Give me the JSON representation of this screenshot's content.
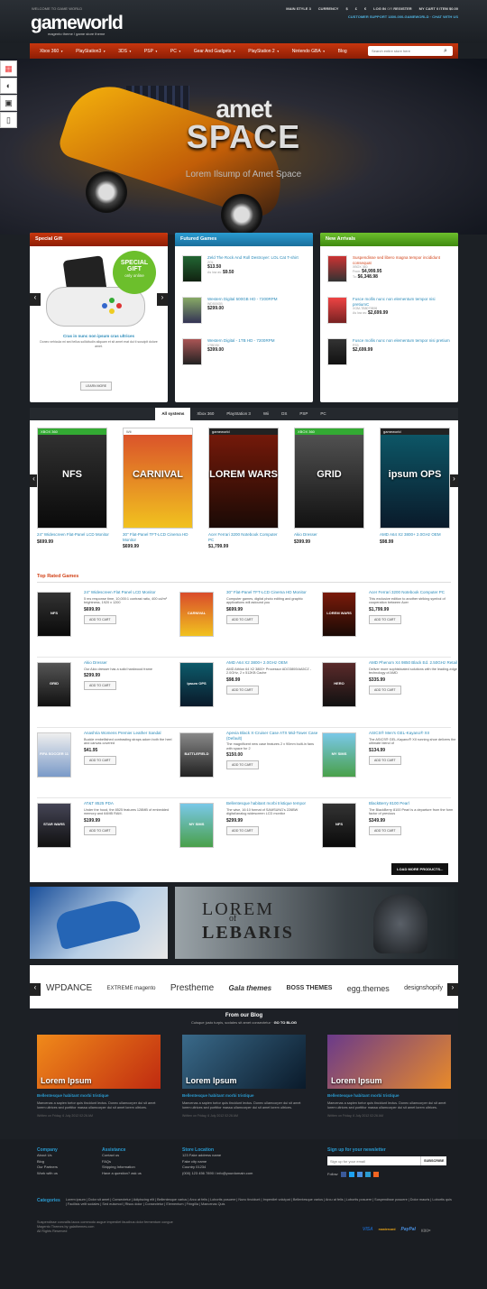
{
  "topbar": {
    "welcome": "WELCOME TO GAME WORLD",
    "logo": "gameworld",
    "logo_sub": "magento theme / game store theme",
    "menu": [
      "MAIN STYLE 3",
      "CURRENCY",
      "$",
      "£",
      "€",
      "LOG IN",
      "OR",
      "REGISTER",
      "MY CART",
      "0",
      "ITEM",
      "$0.00"
    ],
    "support": "CUSTOMER SUPPORT 1800-000-GAMEWORLD · CHAT WITH US"
  },
  "nav": {
    "items": [
      "Xbox 360",
      "PlayStation3",
      "3DS",
      "PSP",
      "PC",
      "Gear And Gadgets",
      "PlayStation 2",
      "Nintendo GBA",
      "Blog"
    ],
    "search_placeholder": "Search entire store here"
  },
  "hero": {
    "t1": "amet",
    "t2": "SPACE",
    "t3": "Lorem Ilsump of Amet Space"
  },
  "special": {
    "title": "Special Gift",
    "badge": [
      "SPECIAL",
      "GIFT",
      "only online"
    ],
    "name": "Cras in nunc non ipsum cras ultrices",
    "desc": "Donec vehicula mi sed tellus sollicitudin aliquam et sit amet erat dui ti suscipit dolore amet.",
    "btn": "LEARN MORE"
  },
  "featured": {
    "title": "Futured Games",
    "items": [
      {
        "name": "Zeld The Rock And Roll Destroyer: LOL Cat T-shirt",
        "sku": "ZOL",
        "price": "$13.50",
        "low": "As low as:",
        "low_price": "$9.50"
      },
      {
        "name": "Western Digital 500GB HD - 7200RPM",
        "sku": "WD500GB",
        "price": "$299.00"
      },
      {
        "name": "Western Digital - 1TB HD - 7200RPM",
        "sku": "1TBDSK",
        "price": "$399.00"
      }
    ]
  },
  "arrivals": {
    "title": "New Arrivals",
    "items": [
      {
        "name": "Suspendisse sed libero magna tempor incididunt consequat",
        "sku": "XBOX 360",
        "from": "From:",
        "p1": "$4,999.95",
        "to": "To:",
        "p2": "$6,348.98"
      },
      {
        "name": "Fusce mollis nunc non elementum tempor nisi pretiumC",
        "sku": "XGM-TB8079898",
        "low": "As low as:",
        "price": "$2,699.99"
      },
      {
        "name": "Fusce mollis nunc non elementum tempor nisi pretium",
        "sku": "PS3",
        "price": "$2,699.99"
      }
    ]
  },
  "tabs": [
    "All systems",
    "Xbox 360",
    "PlayStation 3",
    "Wii",
    "DS",
    "PSP",
    "PC"
  ],
  "carousel": [
    {
      "name": "24\" Widescreen Flat-Panel LCD Monitor",
      "price": "$699.99",
      "label": "XBOX 360",
      "art": "NFS"
    },
    {
      "name": "30\" Flat-Panel TFT-LCD Cinema HD Monitor",
      "price": "$699.99",
      "label": "Wii",
      "art": "CARNIVAL"
    },
    {
      "name": "Acer Ferrari 3200 Notebook Computer PC",
      "price": "$1,799.99",
      "label": "gameworld",
      "art": "LOREM WARS"
    },
    {
      "name": "Akio Dresser",
      "price": "$399.99",
      "label": "XBOX 360",
      "art": "GRID"
    },
    {
      "name": "AMD A64 X2 3800+ 2.0GHz OEM",
      "price": "$98.99",
      "label": "gameworld",
      "art": "ipsum OPS"
    }
  ],
  "top_rated": {
    "title": "Top Rated Games",
    "btn": "ADD TO CART",
    "more": "LOAD MORE PRODUCTS...",
    "items": [
      {
        "name": "24\" Widescreen Flat Panel LCD Monitor",
        "desc": "5 ms response time, 10,000:1 contrast ratio, 400 cd/m² brightness, 1920 x 1200",
        "price": "$699.99",
        "art": "NFS"
      },
      {
        "name": "30\" Flat-Panel TFT-LCD Cinema HD Monitor",
        "desc": "Computer games, digital photo editing and graphic applications will astound you",
        "price": "$699.99",
        "art": "CARNIVAL"
      },
      {
        "name": "Acer Ferrari 3200 Notebook Computer PC",
        "desc": "This exclusive edition to another striking symbol of cooperation between Acer",
        "price": "$1,799.99",
        "art": "LOREM WARS"
      },
      {
        "name": "Akio Dresser",
        "desc": "Our Akio dresser has a solid hardwood frame",
        "price": "$299.99",
        "art": "GRID"
      },
      {
        "name": "AMD A64 X2 3800+ 2.0GHz OEM",
        "desc": "AMD Athlon 64 X2 3800+ Processor ADO3800IAA5CZ - 2.0GHz, 2 x 512KB Cache",
        "price": "$98.99",
        "art": "ipsum OPS"
      },
      {
        "name": "AMD Phenom X4 9850 Black Ed. 2.50GHz Retail",
        "desc": "Deliver more sophisticated solutions with the leading-edge technology of AMD",
        "price": "$335.99",
        "art": "HERO"
      },
      {
        "name": "Anashria Womens Premier Leather Sandal",
        "desc": "Buckle embellished contrasting straps adorn both the heel and canvas covered",
        "price": "$41.95",
        "art": "FIFA SOCCER 11"
      },
      {
        "name": "Apevia Black X-Cruiser Case ATX Mid-Tower Case (Default)",
        "desc": "The magnificent new case features 2 x 90mm built-in fans with space for 2",
        "price": "$150.00",
        "art": "BATTLEFIELD"
      },
      {
        "name": "ASICS® Men's GEL-Kayano® XII",
        "desc": "The ASICS® GEL-Kayano® XII running shoe delivers the ultimate blend of",
        "price": "$134.99",
        "art": "MY SIMS"
      },
      {
        "name": "AT&T 8525 PDA",
        "desc": "Under the hood, the 8525 features 128MB of embedded memory and 64MB RAM.",
        "price": "$199.99",
        "art": "STAR WARS"
      },
      {
        "name": "Bellentesque habitant morbi tristique tempor",
        "desc": "The wise, 16:10 format of SAMSUNG's 226BW digital/analog widescreen LCD monitor",
        "price": "$299.99",
        "art": "MY SIMS"
      },
      {
        "name": "BlackBerry 8100 Pearl",
        "desc": "The BlackBerry 8100 Pearl is a departure from the form factor of previous",
        "price": "$349.99",
        "art": "NFS"
      }
    ]
  },
  "banners": {
    "right_1": "LOREM",
    "right_of": "of",
    "right_2": "LEBARIS"
  },
  "brands": [
    "WPDANCE",
    "EXTREME magento",
    "Prestheme",
    "Gala themes",
    "BOSS THEMES",
    "egg.themes",
    "designshopify"
  ],
  "blog": {
    "title": "From our Blog",
    "sub": "Cuisque justo turpis, sodales sit amet consectetur",
    "link": "GO TO BLOG",
    "posts": [
      {
        "img": "Lorem Ipsum",
        "title": "Bellentesque habitant morbi tristique",
        "text": "Maecenas a sapien tortor quis tincidunt lectus. Donec ullamcorper dui sit amet lorem ultrices sed porttitor massa ullamcorper dui sit amet lorem ultrices.",
        "date": "Written on Friday, 6 July 2012 02:26 AM"
      },
      {
        "img": "Lorem Ipsum",
        "title": "Bellentesque habitant morbi tristique",
        "text": "Maecenas a sapien tortor quis tincidunt lectus. Donec ullamcorper dui sit amet lorem ultrices sed porttitor massa ullamcorper dui sit amet lorem ultrices.",
        "date": "Written on Friday, 6 July 2012 02:26 AM"
      },
      {
        "img": "Lorem Ipsum",
        "title": "Bellentesque habitant morbi tristique",
        "text": "Maecenas a sapien tortor quis tincidunt lectus. Donec ullamcorper dui sit amet lorem ultrices sed porttitor massa ullamcorper dui sit amet lorem ultrices.",
        "date": "Written on Friday, 6 July 2012 02:26 AM"
      }
    ]
  },
  "footer": {
    "company": {
      "title": "Company",
      "links": [
        "About Us",
        "Blog",
        "Our Partners",
        "Work with us"
      ]
    },
    "assistance": {
      "title": "Assistance",
      "links": [
        "Contact us",
        "FAQs",
        "Shipping Information",
        "Have a question? ask us"
      ]
    },
    "store": {
      "title": "Store Location",
      "lines": [
        "123 Fake address name",
        "Fake city name",
        "Country 01234",
        "(000) 123 456 7890 / info@yourdomain.com"
      ]
    },
    "newsletter": {
      "title": "Sign up for your newsletter",
      "placeholder": "Sign up for your email",
      "btn": "SUBSCRIBE",
      "follow": "Follow"
    },
    "categories_label": "Categories",
    "categories": "Lorem ipsum | Dolor sit amet | Consectetur | Adipiscing elit | Bellentesque varius | Arcu at felis | Lobortis posuere | Nunc tincidunt | Imperdiet volutpat | Bellentesque varius | Arcu at felis | Lobortis posuere | Suspendisse posuere | Dolor mauris | Lobortis quis | Facilisis velit sodales | Sed euismod | Risus dolor | Consectetur | Elementum | Fringilla | Maecenas Quis",
    "copyright": [
      "Suspendisse convallis lacus commodo augue imperdiet faucibus dolor fermentum congue",
      "Magento Themes by galathemes.com",
      "All Rights Reserved"
    ],
    "payments": [
      "VISA",
      "mastercard",
      "PayPal",
      "((((((o"
    ]
  }
}
